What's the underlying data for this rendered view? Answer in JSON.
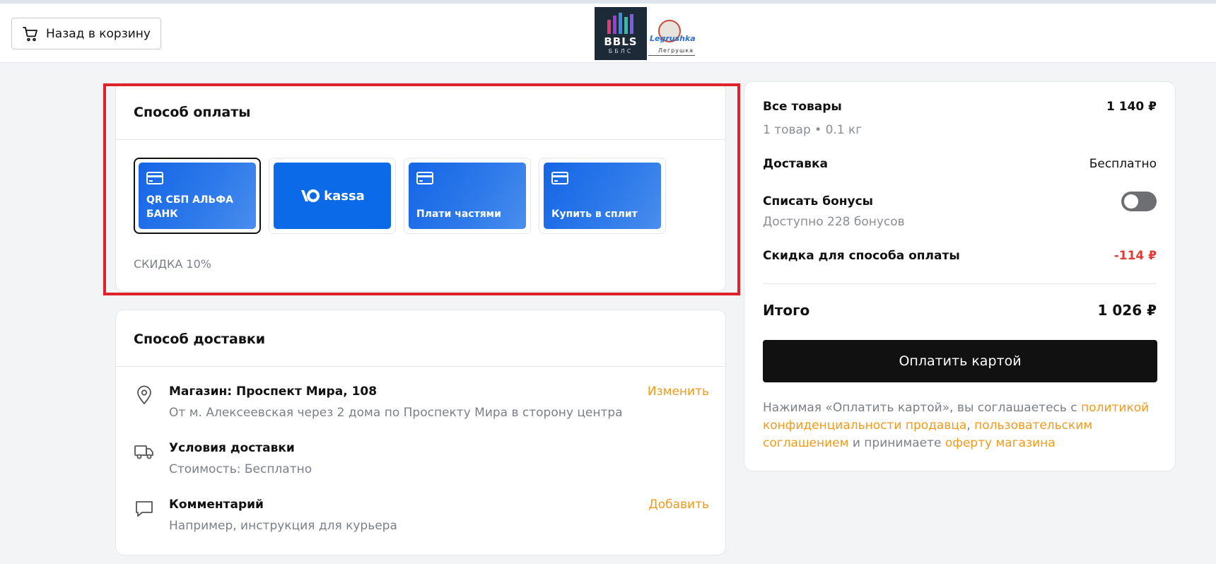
{
  "header": {
    "back_label": "Назад в корзину",
    "logo_bbls_text": "BBLS",
    "logo_bbls_sub": "ББЛС",
    "logo_toy_text": "Legrushka",
    "logo_toy_sub": "Легрушка"
  },
  "payment": {
    "title": "Способ оплаты",
    "options": [
      {
        "label": "QR СБП АЛЬФА БАНК",
        "selected": true
      },
      {
        "label": "kassa",
        "selected": false
      },
      {
        "label": "Плати частями",
        "selected": false
      },
      {
        "label": "Купить в сплит",
        "selected": false
      }
    ],
    "discount": "СКИДКА 10%"
  },
  "delivery": {
    "title": "Способ доставки",
    "rows": [
      {
        "title": "Магазин: Проспект Мира, 108",
        "sub": "От м. Алексеевская через 2 дома по Проспекту Мира в сторону центра",
        "action": "Изменить",
        "icon": "location-pin-icon"
      },
      {
        "title": "Условия доставки",
        "sub": "Стоимость: Бесплатно",
        "action": "",
        "icon": "truck-icon"
      },
      {
        "title": "Комментарий",
        "sub": "Например, инструкция для курьера",
        "action": "Добавить",
        "icon": "comment-icon"
      }
    ]
  },
  "summary": {
    "items_label": "Все товары",
    "items_value": "1 140 ₽",
    "items_sub": "1 товар • 0.1 кг",
    "delivery_label": "Доставка",
    "delivery_value": "Бесплатно",
    "bonus_label": "Списать бонусы",
    "bonus_sub": "Доступно 228 бонусов",
    "bonus_toggle_on": false,
    "discount_label": "Скидка для способа оплаты",
    "discount_value": "-114 ₽",
    "total_label": "Итого",
    "total_value": "1 026 ₽",
    "pay_button": "Оплатить картой",
    "terms": {
      "pre": "Нажимая «Оплатить картой», вы соглашаетесь с ",
      "link1": "политикой конфиденциальности продавца",
      "sep": ", ",
      "link2": "пользовательским соглашением",
      "mid": " и принимаете ",
      "link3": "оферту магазина"
    }
  },
  "colors": {
    "accent_orange": "#f39a1b",
    "pay_blue": "#1565e6",
    "highlight_red": "#e0222a",
    "negative_red": "#e53935"
  }
}
